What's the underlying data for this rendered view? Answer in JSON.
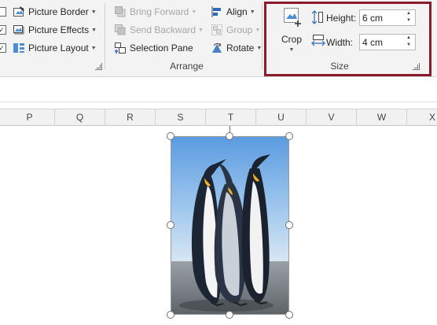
{
  "ribbon": {
    "picture_styles": {
      "border_label": "Picture Border",
      "effects_label": "Picture Effects",
      "layout_label": "Picture Layout"
    },
    "arrange": {
      "bring_forward_label": "Bring Forward",
      "send_backward_label": "Send Backward",
      "selection_pane_label": "Selection Pane",
      "align_label": "Align",
      "group_label": "Group",
      "rotate_label": "Rotate",
      "group_title": "Arrange"
    },
    "size": {
      "crop_label": "Crop",
      "height_label": "Height:",
      "height_value": "6 cm",
      "width_label": "Width:",
      "width_value": "4 cm",
      "group_title": "Size"
    }
  },
  "sheet": {
    "columns": [
      "P",
      "Q",
      "R",
      "S",
      "T",
      "U",
      "V",
      "W",
      "X"
    ]
  },
  "colors": {
    "highlight_border": "#8b1a2a",
    "ribbon_bg": "#f3f3f3",
    "accent_blue": "#2b6cb8"
  }
}
